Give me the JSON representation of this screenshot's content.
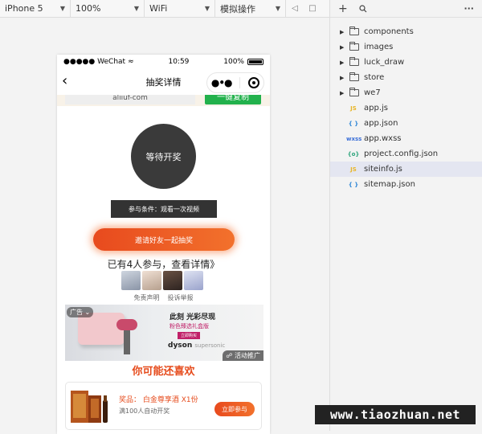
{
  "toolbar": {
    "device": "iPhone 5",
    "zoom": "100%",
    "network": "WiFi",
    "operation": "模拟操作"
  },
  "statusbar": {
    "carrier": "●●●●● WeChat",
    "time": "10:59",
    "battery": "100%"
  },
  "navbar": {
    "title": "抽奖详情"
  },
  "copybar": {
    "input_value": "aliiuf-com",
    "copy_label": "一键复制"
  },
  "draw": {
    "status": "等待开奖",
    "condition": "参与条件：观看一次视频",
    "invite_label": "邀请好友一起抽奖",
    "joined_text": "已有4人参与，查看详情》",
    "disclaimer": "免责声明",
    "report": "投诉举报"
  },
  "ad": {
    "tag": "广告",
    "title": "此刻 光彩尽现",
    "subtitle": "粉色臻选礼盒版",
    "buy": "立即购买",
    "brand": "dyson",
    "brand_sub": "supersonic",
    "promo": "活动推广"
  },
  "recommend": {
    "title": "你可能还喜欢",
    "prize": "奖品：  白金尊享酒 X1份",
    "count": "满100人自动开奖",
    "join_label": "立即参与"
  },
  "explorer": {
    "items": [
      {
        "type": "folder",
        "name": "components"
      },
      {
        "type": "folder",
        "name": "images"
      },
      {
        "type": "folder",
        "name": "luck_draw"
      },
      {
        "type": "folder",
        "name": "store"
      },
      {
        "type": "folder",
        "name": "we7"
      },
      {
        "type": "js",
        "name": "app.js",
        "badge": "JS"
      },
      {
        "type": "json",
        "name": "app.json",
        "badge": "{ }"
      },
      {
        "type": "wxss",
        "name": "app.wxss",
        "badge": "wxss"
      },
      {
        "type": "config",
        "name": "project.config.json",
        "badge": "{o}"
      },
      {
        "type": "js",
        "name": "siteinfo.js",
        "badge": "JS",
        "selected": true
      },
      {
        "type": "json",
        "name": "sitemap.json",
        "badge": "{ }"
      }
    ]
  },
  "watermark": "www.tiaozhuan.net",
  "colors": {
    "accent_orange": "#e64b1c",
    "copy_green": "#22b14c",
    "js_yellow": "#e8b526",
    "json_blue": "#2f86d6",
    "wxss_blue": "#3b6fd8",
    "config_green": "#2aa37a"
  }
}
